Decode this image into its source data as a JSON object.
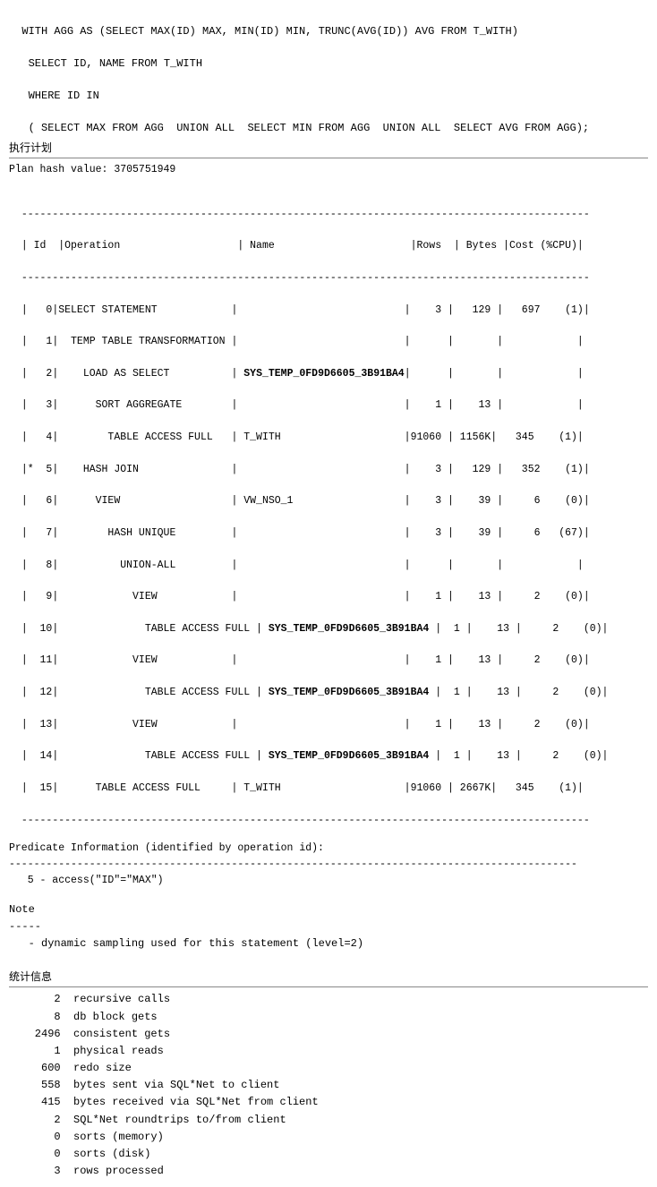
{
  "sql": {
    "line1": "WITH AGG AS (SELECT MAX(ID) MAX, MIN(ID) MIN, TRUNC(AVG(ID)) AVG FROM T_WITH)",
    "line2": " SELECT ID, NAME FROM T_WITH",
    "line3": " WHERE ID IN",
    "line4": " ( SELECT MAX FROM AGG  UNION ALL  SELECT MIN FROM AGG  UNION ALL  SELECT AVG FROM AGG);",
    "section_title": "执行计划"
  },
  "plan": {
    "hash_label": "Plan hash value: 3705751949",
    "divider": "--------------------------------------------------------------------------------------------",
    "header": "| Id  |Operation                   | Name                      |Rows  | Bytes |Cost (%CPU)|",
    "rows": [
      "|   0|SELECT STATEMENT            |                           |    3 |   129 |   697    (1)|",
      "|   1|  TEMP TABLE TRANSFORMATION |                           |      |       |            |",
      "|   2|    LOAD AS SELECT          | SYS_TEMP_0FD9D6605_3B91BA4|      |       |            |",
      "|   3|      SORT AGGREGATE        |                           |    1 |    13 |            |",
      "|   4|        TABLE ACCESS FULL   | T_WITH                    |91060 | 1156K |   345    (1)|",
      "|*  5|    HASH JOIN               |                           |    3 |   129 |   352    (1)|",
      "|   6|      VIEW                  | VW_NSO_1                  |    3 |    39 |     6    (0)|",
      "|   7|        HASH UNIQUE         |                           |    3 |    39 |     6   (67)|",
      "|   8|          UNION-ALL         |                           |      |       |            |",
      "|   9|            VIEW            |                           |    1 |    13 |     2    (0)|",
      "|  10|              TABLE ACCESS FULL | SYS_TEMP_0FD9D6605_3B91BA4 |  1 |    13 |     2    (0)|",
      "|  11|            VIEW            |                           |    1 |    13 |     2    (0)|",
      "|  12|              TABLE ACCESS FULL | SYS_TEMP_0FD9D6605_3B91BA4 |  1 |    13 |     2    (0)|",
      "|  13|            VIEW            |                           |    1 |    13 |     2    (0)|",
      "|  14|              TABLE ACCESS FULL | SYS_TEMP_0FD9D6605_3B91BA4 |  1 |    13 |     2    (0)|",
      "|  15|      TABLE ACCESS FULL     | T_WITH                    |91060 | 2667K |   345    (1)|"
    ]
  },
  "predicate": {
    "title": "Predicate Information (identified by operation id):",
    "content": "   5 - access(\"ID\"=\"MAX\")"
  },
  "note": {
    "title": "Note",
    "dashes": "-----",
    "content": "   - dynamic sampling used for this statement (level=2)"
  },
  "stats": {
    "section_title": "统计信息",
    "items": [
      {
        "value": "2",
        "label": "recursive calls"
      },
      {
        "value": "8",
        "label": "db block gets"
      },
      {
        "value": "2496",
        "label": "consistent gets"
      },
      {
        "value": "1",
        "label": "physical reads"
      },
      {
        "value": "600",
        "label": "redo size"
      },
      {
        "value": "558",
        "label": "bytes sent via SQL*Net to client"
      },
      {
        "value": "415",
        "label": "bytes received via SQL*Net from client"
      },
      {
        "value": "2",
        "label": "SQL*Net roundtrips to/from client"
      },
      {
        "value": "0",
        "label": "sorts (memory)"
      },
      {
        "value": "0",
        "label": "sorts (disk)"
      },
      {
        "value": "3",
        "label": "rows processed"
      }
    ]
  }
}
